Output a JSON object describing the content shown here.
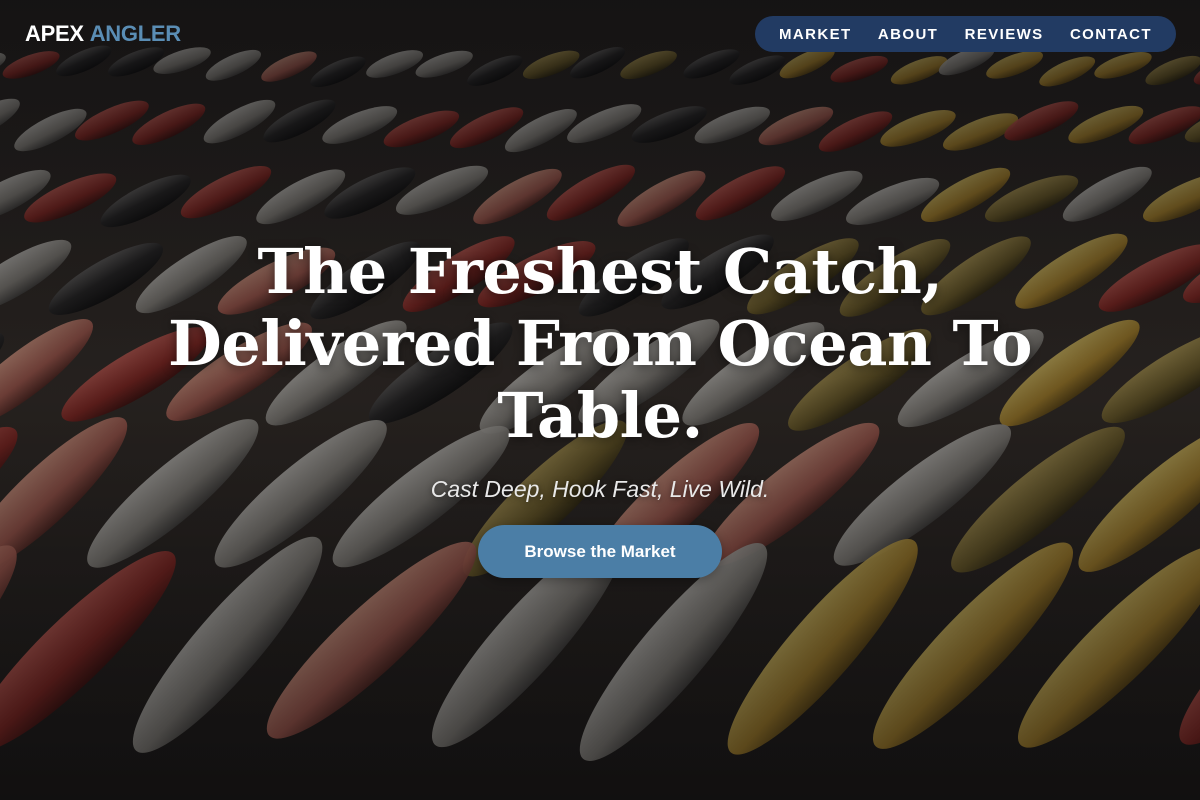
{
  "brand": {
    "name_part1": "APEX",
    "name_part2": "ANGLER",
    "accent_color": "#5a8db4"
  },
  "nav": {
    "background_color": "#223b63",
    "items": [
      {
        "label": "MARKET"
      },
      {
        "label": "ABOUT"
      },
      {
        "label": "REVIEWS"
      },
      {
        "label": "CONTACT"
      }
    ]
  },
  "hero": {
    "background_image": "fish-market-photo",
    "headline_line1": "The Freshest Catch,",
    "headline_line2": "Delivered From Ocean To",
    "headline_line3": "Table.",
    "tagline": "Cast Deep, Hook Fast, Live Wild.",
    "cta_label": "Browse the Market",
    "cta_color": "#4b7ea6"
  }
}
